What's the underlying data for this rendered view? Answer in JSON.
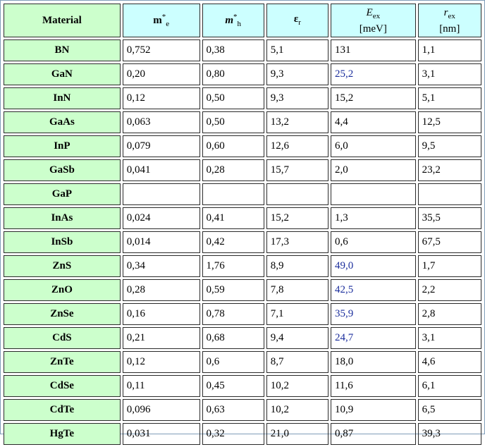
{
  "headers": {
    "material": "Material",
    "me": {
      "base": "m",
      "sup": "*",
      "sub": "e"
    },
    "mh": {
      "base": "m",
      "sup": "*",
      "sub": "h"
    },
    "eps": {
      "base": "ε",
      "sub": "r"
    },
    "eex": {
      "base": "E",
      "sub": "ex",
      "unit": "[meV]"
    },
    "rex": {
      "base": "r",
      "sub": "ex",
      "unit": "[nm]"
    }
  },
  "rows": [
    {
      "material": "BN",
      "me": "0,752",
      "mh": "0,38",
      "eps": "5,1",
      "eex": "131",
      "rex": "1,1",
      "highlight": false
    },
    {
      "material": "GaN",
      "me": "0,20",
      "mh": "0,80",
      "eps": "9,3",
      "eex": "25,2",
      "rex": "3,1",
      "highlight": true
    },
    {
      "material": "InN",
      "me": "0,12",
      "mh": "0,50",
      "eps": "9,3",
      "eex": "15,2",
      "rex": "5,1",
      "highlight": false
    },
    {
      "material": "GaAs",
      "me": "0,063",
      "mh": "0,50",
      "eps": "13,2",
      "eex": "4,4",
      "rex": "12,5",
      "highlight": false
    },
    {
      "material": "InP",
      "me": "0,079",
      "mh": "0,60",
      "eps": "12,6",
      "eex": "6,0",
      "rex": "9,5",
      "highlight": false
    },
    {
      "material": "GaSb",
      "me": "0,041",
      "mh": "0,28",
      "eps": "15,7",
      "eex": "2,0",
      "rex": "23,2",
      "highlight": false
    },
    {
      "material": "GaP",
      "me": "",
      "mh": "",
      "eps": "",
      "eex": "",
      "rex": "",
      "highlight": false
    },
    {
      "material": "InAs",
      "me": "0,024",
      "mh": "0,41",
      "eps": "15,2",
      "eex": "1,3",
      "rex": "35,5",
      "highlight": false
    },
    {
      "material": "InSb",
      "me": "0,014",
      "mh": "0,42",
      "eps": "17,3",
      "eex": "0,6",
      "rex": "67,5",
      "highlight": false
    },
    {
      "material": "ZnS",
      "me": "0,34",
      "mh": "1,76",
      "eps": "8,9",
      "eex": "49,0",
      "rex": "1,7",
      "highlight": true
    },
    {
      "material": "ZnO",
      "me": "0,28",
      "mh": "0,59",
      "eps": "7,8",
      "eex": "42,5",
      "rex": "2,2",
      "highlight": true
    },
    {
      "material": "ZnSe",
      "me": "0,16",
      "mh": "0,78",
      "eps": "7,1",
      "eex": "35,9",
      "rex": "2,8",
      "highlight": true
    },
    {
      "material": "CdS",
      "me": "0,21",
      "mh": "0,68",
      "eps": "9,4",
      "eex": "24,7",
      "rex": "3,1",
      "highlight": true
    },
    {
      "material": "ZnTe",
      "me": "0,12",
      "mh": "0,6",
      "eps": "8,7",
      "eex": "18,0",
      "rex": "4,6",
      "highlight": false
    },
    {
      "material": "CdSe",
      "me": "0,11",
      "mh": "0,45",
      "eps": "10,2",
      "eex": "11,6",
      "rex": "6,1",
      "highlight": false
    },
    {
      "material": "CdTe",
      "me": "0,096",
      "mh": "0,63",
      "eps": "10,2",
      "eex": "10,9",
      "rex": "6,5",
      "highlight": false
    },
    {
      "material": "HgTe",
      "me": "0,031",
      "mh": "0,32",
      "eps": "21,0",
      "eex": "0,87",
      "rex": "39,3",
      "highlight": false
    }
  ],
  "colors": {
    "material_bg": "#ccffcc",
    "header_bg": "#ccffff",
    "highlight_text": "#1a2d9c",
    "border": "#2b2b2b"
  }
}
